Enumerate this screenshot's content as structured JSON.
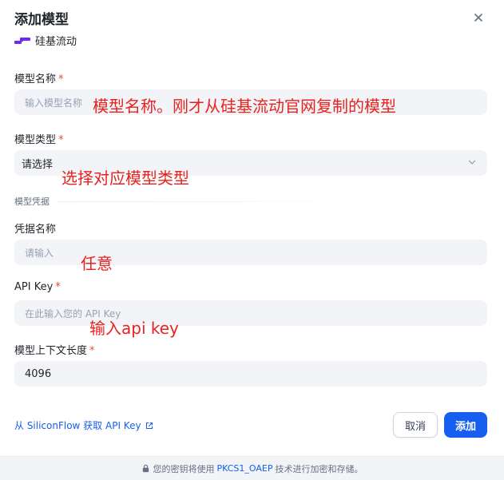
{
  "dialog": {
    "title": "添加模型",
    "provider_name": "硅基流动",
    "close_icon": "close-icon"
  },
  "fields": {
    "model_name": {
      "label": "模型名称",
      "required_mark": "*",
      "placeholder": "输入模型名称"
    },
    "model_type": {
      "label": "模型类型",
      "required_mark": "*",
      "value": "请选择"
    },
    "credentials_section": "模型凭据",
    "credential_name": {
      "label": "凭据名称",
      "placeholder": "请输入"
    },
    "api_key": {
      "label": "API Key",
      "required_mark": "*",
      "placeholder": "在此输入您的 API Key"
    },
    "context_length": {
      "label": "模型上下文长度",
      "required_mark": "*",
      "value": "4096"
    }
  },
  "annotations": {
    "model_name": "模型名称。刚才从硅基流动官网复制的模型",
    "model_type": "选择对应模型类型",
    "credential_name": "任意",
    "api_key": "输入api key"
  },
  "actions": {
    "get_key_link": "从 SiliconFlow 获取 API Key",
    "cancel": "取消",
    "add": "添加"
  },
  "footer": {
    "prefix": "您的密钥将使用",
    "highlight": "PKCS1_OAEP",
    "suffix": "技术进行加密和存储。"
  },
  "colors": {
    "primary": "#155eef",
    "annotation": "#e8231f",
    "required": "#f04438",
    "field_bg": "#f2f4f7"
  }
}
